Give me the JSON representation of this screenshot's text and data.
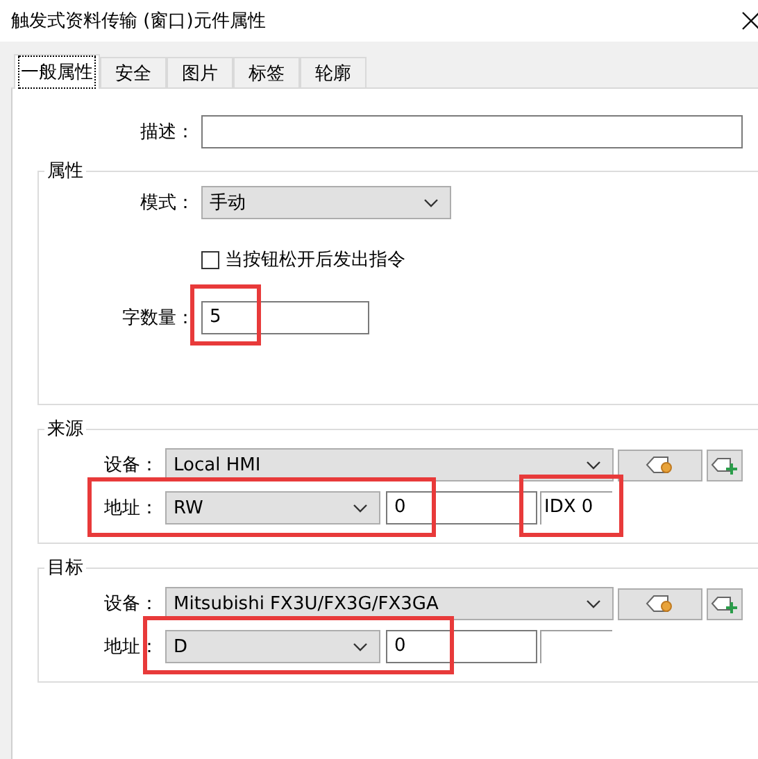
{
  "window": {
    "title": "触发式资料传输 (窗口)元件属性"
  },
  "tabs": [
    {
      "label": "一般属性",
      "selected": true
    },
    {
      "label": "安全",
      "selected": false
    },
    {
      "label": "图片",
      "selected": false
    },
    {
      "label": "标签",
      "selected": false
    },
    {
      "label": "轮廓",
      "selected": false
    }
  ],
  "description": {
    "label": "描述："
  },
  "attributes": {
    "title": "属性",
    "mode": {
      "label": "模式：",
      "value": "手动"
    },
    "release_checkbox": {
      "label": "当按钮松开后发出指令",
      "checked": false
    },
    "word_count": {
      "label": "字数量：",
      "value": "5",
      "highlighted": true
    }
  },
  "source": {
    "title": "来源",
    "device": {
      "label": "设备：",
      "value": "Local HMI"
    },
    "address": {
      "label": "地址：",
      "type": "RW",
      "value": "0",
      "highlighted": true
    },
    "index": {
      "text": "IDX 0",
      "highlighted": true
    }
  },
  "target": {
    "title": "目标",
    "device": {
      "label": "设备：",
      "value": "Mitsubishi FX3U/FX3G/FX3GA"
    },
    "address": {
      "label": "地址：",
      "type": "D",
      "value": "0",
      "highlighted": true
    }
  }
}
